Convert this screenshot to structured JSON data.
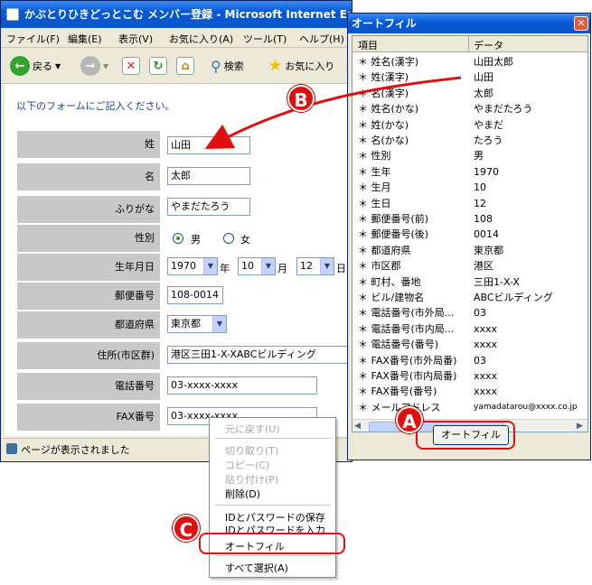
{
  "ie_window": {
    "title": "かぶとりひきどっとこむ メンバー登録 - Microsoft Internet Explorer",
    "menus": [
      "ファイル(F)",
      "編集(E)",
      "表示(V)",
      "お気に入り(A)",
      "ツール(T)",
      "ヘルプ(H)"
    ],
    "toolbar": {
      "back": "戻る",
      "search": "検索",
      "favorites": "お気に入り"
    },
    "status": "ページが表示されました"
  },
  "form": {
    "intro": "以下のフォームにご記入ください。",
    "fields": {
      "sei": {
        "label": "姓",
        "value": "山田"
      },
      "mei": {
        "label": "名",
        "value": "太郎"
      },
      "furigana": {
        "label": "ふりがな",
        "value": "やまだたろう"
      },
      "gender": {
        "label": "性別",
        "male": "男",
        "female": "女",
        "selected": "男"
      },
      "birth": {
        "label": "生年月日",
        "year": "1970",
        "year_unit": "年",
        "month": "10",
        "month_unit": "月",
        "day": "12",
        "day_unit": "日"
      },
      "zip": {
        "label": "郵便番号",
        "value": "108-0014"
      },
      "pref": {
        "label": "都道府県",
        "value": "東京都"
      },
      "address": {
        "label": "住所(市区群)",
        "value": "港区三田1-X-XABCビルディング"
      },
      "tel": {
        "label": "電話番号",
        "value": "03-xxxx-xxxx"
      },
      "fax": {
        "label": "FAX番号",
        "value": "03-xxxx-xxxx"
      }
    }
  },
  "autofill": {
    "title": "オートフィル",
    "headers": [
      "項目",
      "データ"
    ],
    "rows": [
      {
        "k": "姓名(漢字)",
        "v": "山田太郎"
      },
      {
        "k": "姓(漢字)",
        "v": "山田"
      },
      {
        "k": "名(漢字)",
        "v": "太郎"
      },
      {
        "k": "姓名(かな)",
        "v": "やまだたろう"
      },
      {
        "k": "姓(かな)",
        "v": "やまだ"
      },
      {
        "k": "名(かな)",
        "v": "たろう"
      },
      {
        "k": "性別",
        "v": "男"
      },
      {
        "k": "生年",
        "v": "1970"
      },
      {
        "k": "生月",
        "v": "10"
      },
      {
        "k": "生日",
        "v": "12"
      },
      {
        "k": "郵便番号(前)",
        "v": "108"
      },
      {
        "k": "郵便番号(後)",
        "v": "0014"
      },
      {
        "k": "都道府県",
        "v": "東京都"
      },
      {
        "k": "市区郡",
        "v": "港区"
      },
      {
        "k": "町村、番地",
        "v": "三田1-X-X"
      },
      {
        "k": "ビル/建物名",
        "v": "ABCビルディング"
      },
      {
        "k": "電話番号(市外局...",
        "v": "03"
      },
      {
        "k": "電話番号(市内局...",
        "v": "xxxx"
      },
      {
        "k": "電話番号(番号)",
        "v": "xxxx"
      },
      {
        "k": "FAX番号(市外局番)",
        "v": "03"
      },
      {
        "k": "FAX番号(市内局番)",
        "v": "xxxx"
      },
      {
        "k": "FAX番号(番号)",
        "v": "xxxx"
      },
      {
        "k": "メールアドレス",
        "v": "yamadatarou@xxxx.co.jp"
      }
    ],
    "button": "オートフィル"
  },
  "context_menu": {
    "undo": "元に戻す(U)",
    "cut": "切り取り(T)",
    "copy": "コピー(C)",
    "paste": "貼り付け(P)",
    "delete": "削除(D)",
    "save_id": "IDとパスワードの保存",
    "input_id": "IDとパスワードを入力",
    "autofill": "オートフィル",
    "select_all": "すべて選択(A)"
  },
  "callouts": {
    "a": "A",
    "b": "B",
    "c": "C"
  },
  "colors": {
    "accent": "#e01010",
    "xp_title": "#0758d8"
  }
}
